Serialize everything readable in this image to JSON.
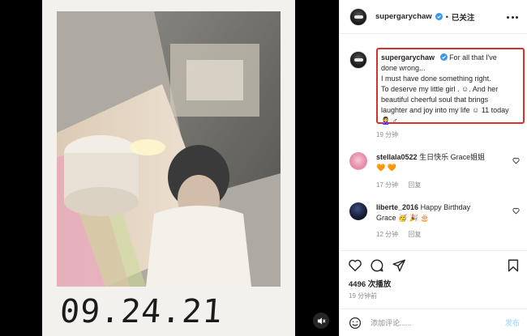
{
  "media": {
    "date_stamp": "09.24.21"
  },
  "post": {
    "author": "supergarychaw",
    "follow_separator": "•",
    "follow_label": "已关注",
    "caption_author": "supergarychaw",
    "caption_lines": [
      "For all that I've",
      "done wrong...",
      "I must have done something right.",
      "To deserve my little girl . ☺. And her",
      "beautiful cheerful soul that brings",
      "laughter and joy into my life ☺ 11 today",
      "🙎‍♀️ ♂"
    ],
    "caption_time": "19 分钟"
  },
  "comments": [
    {
      "username": "stellala0522",
      "text": "生日快乐 Grace姐姐",
      "text_line2": "🧡 🧡",
      "time": "17 分钟",
      "reply_label": "回复"
    },
    {
      "username": "liberte_2016",
      "text": "Happy Birthday",
      "text_line2": "Grace 🥳 🎉 🎂",
      "time": "12 分钟",
      "reply_label": "回复"
    }
  ],
  "stats": {
    "likes": "4496 次播放",
    "time_ago": "19 分钟前"
  },
  "composer": {
    "placeholder": "添加评论......",
    "post_label": "发布"
  },
  "icons": {
    "verified": "verified-badge-icon",
    "more": "more-options-icon",
    "like": "heart-icon",
    "comment": "comment-icon",
    "share": "share-icon",
    "save": "bookmark-icon",
    "emoji": "emoji-icon",
    "mute": "muted-speaker-icon"
  },
  "colors": {
    "verified_blue": "#3897f0",
    "highlight_red": "#d9302c",
    "post_disabled": "#b2dffc"
  }
}
